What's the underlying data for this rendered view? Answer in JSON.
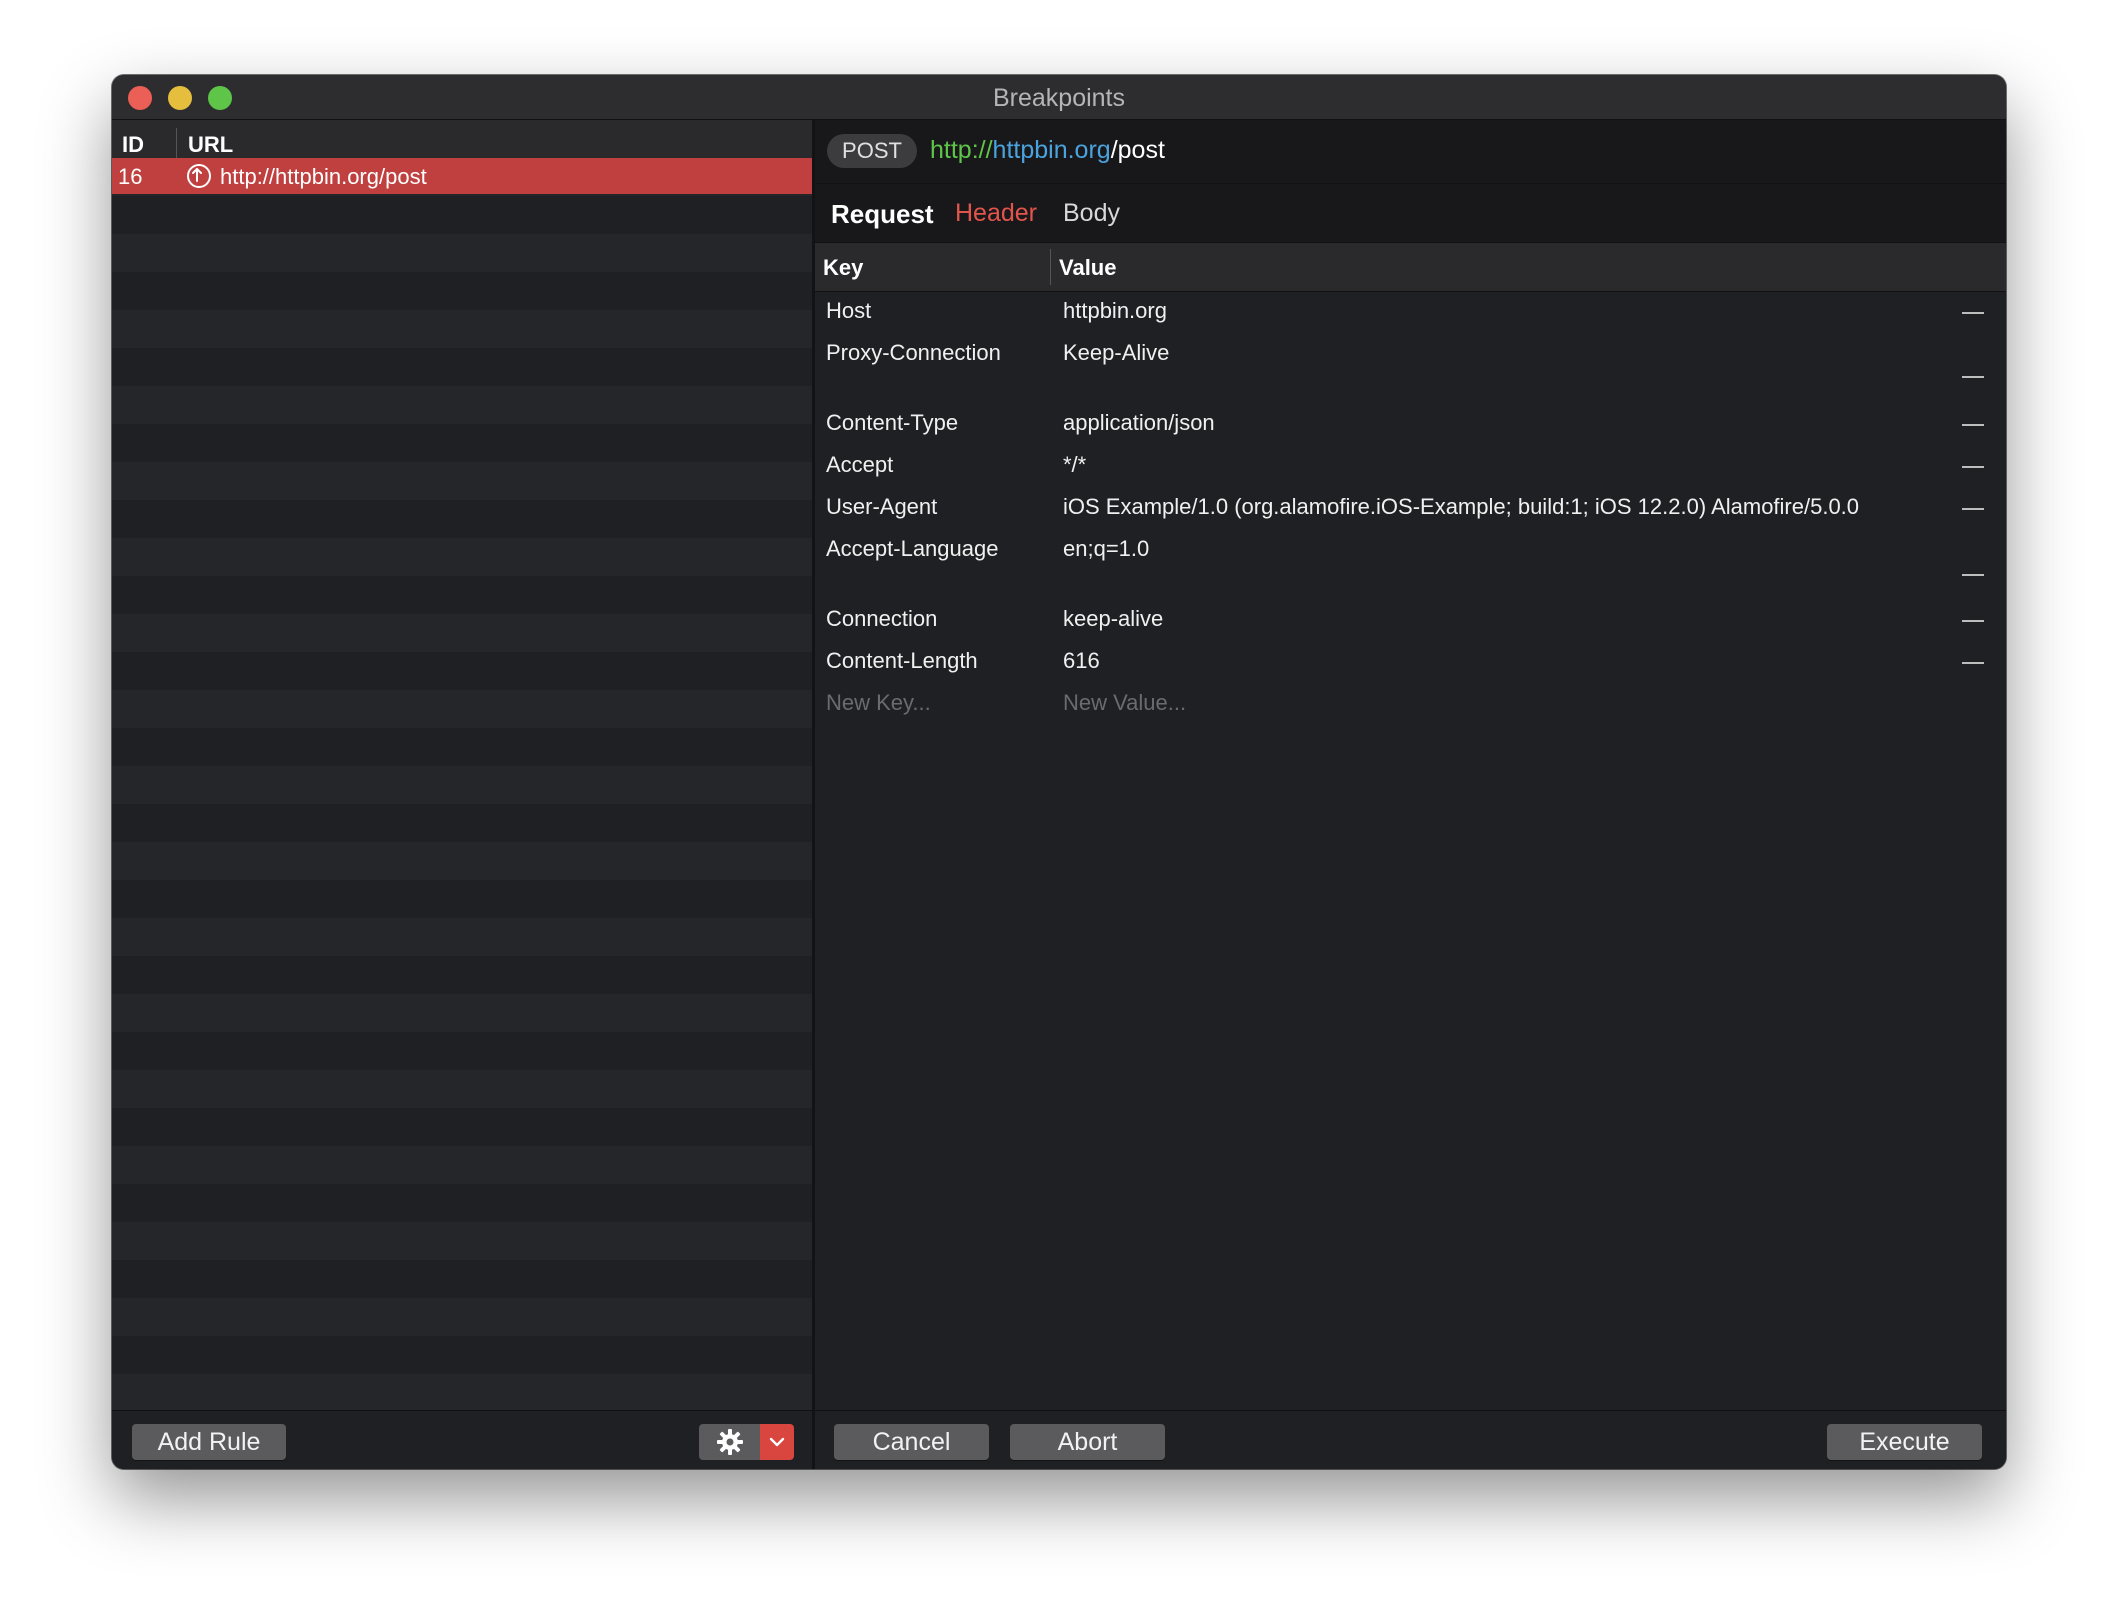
{
  "window": {
    "title": "Breakpoints"
  },
  "rules": {
    "columns": {
      "id": "ID",
      "url": "URL"
    },
    "items": [
      {
        "id": "16",
        "url": "http://httpbin.org/post",
        "icon": "upload-arrow-icon"
      }
    ],
    "add_rule_label": "Add Rule"
  },
  "request": {
    "method": "POST",
    "url_scheme": "http://",
    "url_host": "httpbin.org",
    "url_path": "/post",
    "tabs": {
      "request": "Request",
      "header": "Header",
      "body": "Body"
    },
    "columns": {
      "key": "Key",
      "value": "Value"
    },
    "headers": [
      {
        "key": "Host",
        "value": "httpbin.org"
      },
      {
        "key": "Proxy-Connection",
        "value": "Keep-Alive"
      },
      {
        "key": "Content-Type",
        "value": "application/json"
      },
      {
        "key": "Accept",
        "value": "*/*"
      },
      {
        "key": "User-Agent",
        "value": "iOS Example/1.0 (org.alamofire.iOS-Example; build:1; iOS 12.2.0) Alamofire/5.0.0"
      },
      {
        "key": "Accept-Language",
        "value": "en;q=1.0"
      },
      {
        "key": "Connection",
        "value": "keep-alive"
      },
      {
        "key": "Content-Length",
        "value": "616"
      }
    ],
    "new_key_placeholder": "New Key...",
    "new_value_placeholder": "New Value..."
  },
  "actions": {
    "cancel": "Cancel",
    "abort": "Abort",
    "execute": "Execute"
  },
  "colors": {
    "selection": "#c0403f",
    "url_scheme": "#5ec549",
    "url_host": "#4aa3df",
    "active_tab": "#e2554d",
    "dropdown_accent": "#d94640"
  }
}
